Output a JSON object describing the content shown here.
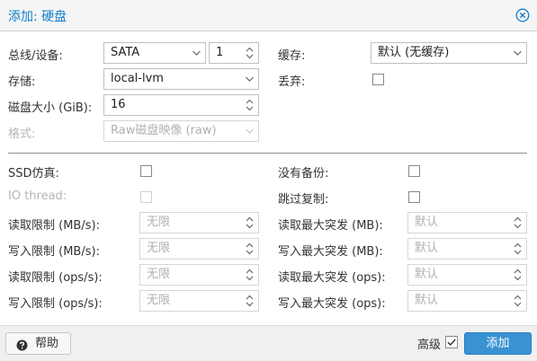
{
  "dialog": {
    "title": "添加: 硬盘"
  },
  "form": {
    "bus_device": {
      "label": "总线/设备:",
      "bus_value": "SATA",
      "device_value": "1"
    },
    "storage": {
      "label": "存储:",
      "value": "local-lvm"
    },
    "disk_size": {
      "label": "磁盘大小 (GiB):",
      "value": "16"
    },
    "format": {
      "label": "格式:",
      "value": "Raw磁盘映像 (raw)"
    },
    "cache": {
      "label": "缓存:",
      "value": "默认 (无缓存)"
    },
    "discard": {
      "label": "丢弃:"
    },
    "ssd_emulation": {
      "label": "SSD仿真:"
    },
    "io_thread": {
      "label": "IO thread:"
    },
    "no_backup": {
      "label": "没有备份:"
    },
    "skip_replication": {
      "label": "跳过复制:"
    },
    "read_limit_mbs": {
      "label": "读取限制 (MB/s):",
      "value": "无限"
    },
    "write_limit_mbs": {
      "label": "写入限制 (MB/s):",
      "value": "无限"
    },
    "read_limit_ops": {
      "label": "读取限制 (ops/s):",
      "value": "无限"
    },
    "write_limit_ops": {
      "label": "写入限制 (ops/s):",
      "value": "无限"
    },
    "read_burst_mb": {
      "label": "读取最大突发 (MB):",
      "value": "默认"
    },
    "write_burst_mb": {
      "label": "写入最大突发 (MB):",
      "value": "默认"
    },
    "read_burst_ops": {
      "label": "读取最大突发 (ops):",
      "value": "默认"
    },
    "write_burst_ops": {
      "label": "写入最大突发 (ops):",
      "value": "默认"
    }
  },
  "footer": {
    "help_label": "帮助",
    "advanced_label": "高级",
    "advanced_checked": true,
    "add_label": "添加"
  },
  "icons": {
    "close": "close-circle-icon",
    "help": "question-circle-icon",
    "dropdown": "chevron-down-icon",
    "spinner": "spinner-arrows-icon"
  },
  "colors": {
    "title": "#157fcc",
    "primary_button": "#3892d4"
  }
}
